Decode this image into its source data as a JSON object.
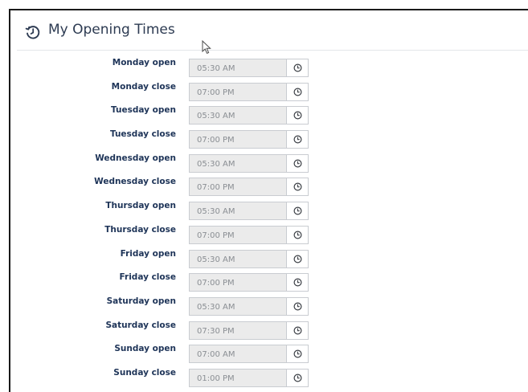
{
  "header": {
    "title": "My Opening Times",
    "icon": "history-clock-icon"
  },
  "colors": {
    "title": "#2d3b52",
    "label": "#1e3458",
    "input_bg": "#ebebeb",
    "input_text": "#8a8e93"
  },
  "rows": [
    {
      "label": "Monday open",
      "value": "05:30 AM"
    },
    {
      "label": "Monday close",
      "value": "07:00 PM"
    },
    {
      "label": "Tuesday open",
      "value": "05:30 AM"
    },
    {
      "label": "Tuesday close",
      "value": "07:00 PM"
    },
    {
      "label": "Wednesday open",
      "value": "05:30 AM"
    },
    {
      "label": "Wednesday close",
      "value": "07:00 PM"
    },
    {
      "label": "Thursday open",
      "value": "05:30 AM"
    },
    {
      "label": "Thursday close",
      "value": "07:00 PM"
    },
    {
      "label": "Friday open",
      "value": "05:30 AM"
    },
    {
      "label": "Friday close",
      "value": "07:00 PM"
    },
    {
      "label": "Saturday open",
      "value": "05:30 AM"
    },
    {
      "label": "Saturday close",
      "value": "07:30 PM"
    },
    {
      "label": "Sunday open",
      "value": "07:00 AM"
    },
    {
      "label": "Sunday close",
      "value": "01:00 PM"
    }
  ],
  "row_icon": "clock-icon"
}
